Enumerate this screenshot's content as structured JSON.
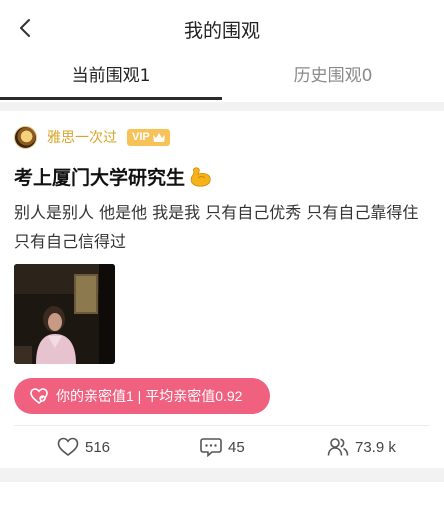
{
  "header": {
    "title": "我的围观",
    "back_icon": "chevron-left-icon"
  },
  "tabs": [
    {
      "label": "当前围观1",
      "active": true
    },
    {
      "label": "历史围观0",
      "active": false
    }
  ],
  "post": {
    "username": "雅思一次过",
    "vip_label": "VIP",
    "title": "考上厦门大学研究生",
    "title_emoji": "muscle-emoji-icon",
    "body": "别人是别人 他是他 我是我 只有自己优秀 只有自己靠得住 只有自己信得过",
    "intimacy_text": "你的亲密值1 | 平均亲密值0.92",
    "stats": {
      "likes": "516",
      "comments": "45",
      "views": "73.9 k"
    }
  },
  "colors": {
    "accent_gold": "#d9a429",
    "vip_badge": "#f7c257",
    "intimacy_pill": "#f0607f",
    "separator": "#f2f2f2"
  }
}
